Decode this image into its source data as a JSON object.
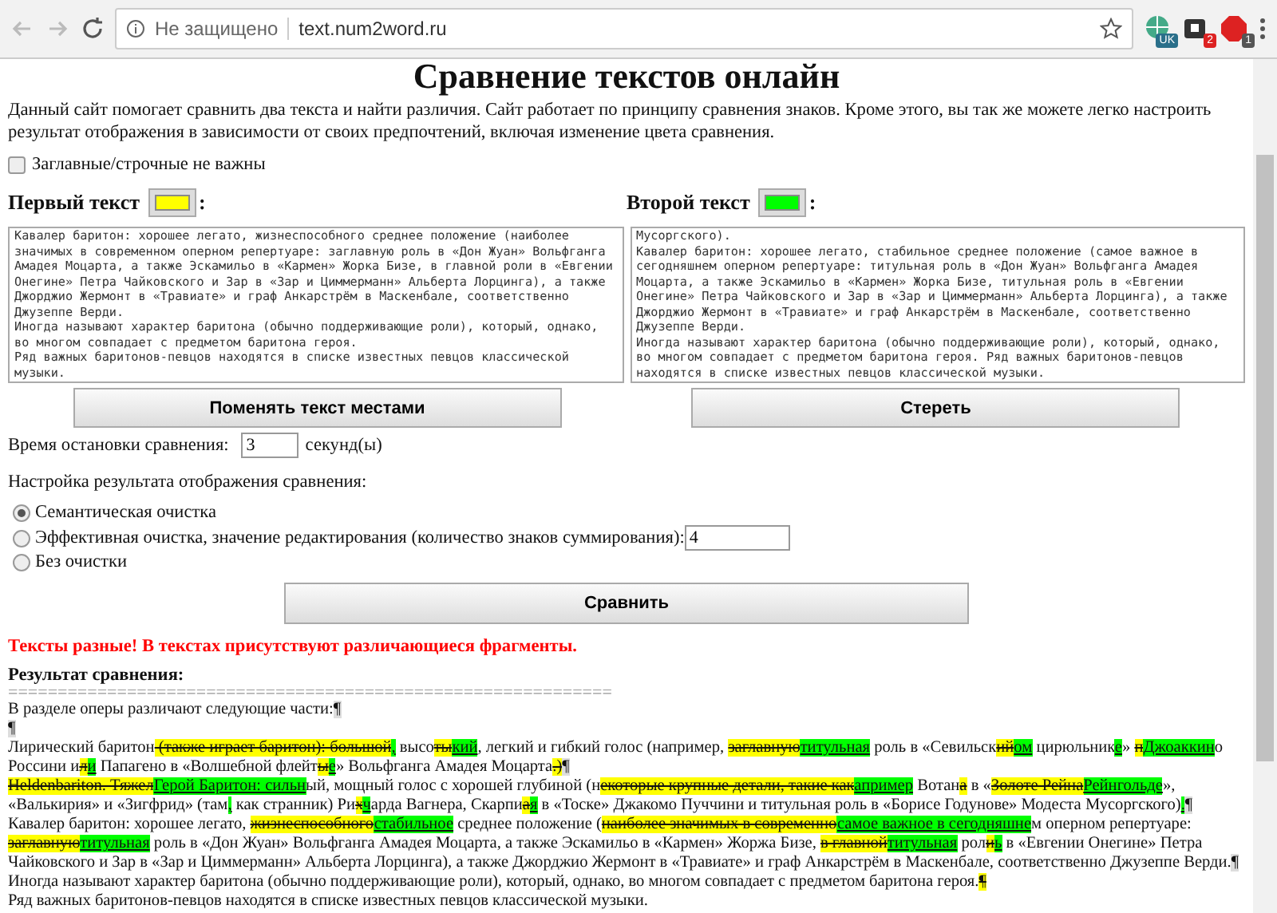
{
  "browser": {
    "security": "Не защищено",
    "url": "text.num2word.ru",
    "extensions": [
      {
        "kind": "globe",
        "badge": "UK"
      },
      {
        "kind": "puzzle",
        "badge": "2"
      },
      {
        "kind": "stop",
        "badge": "1"
      }
    ]
  },
  "title": "Сравнение текстов онлайн",
  "intro": "Данный сайт помогает сравнить два текста и найти различия. Сайт работает по принципу сравнения знаков. Кроме этого, вы так же можете легко настроить результат отображения в зависимости от своих предпочтений, включая изменение цвета сравнения.",
  "case_option": {
    "label": "Заглавные/строчные не важны",
    "checked": false
  },
  "texts": [
    {
      "label": "Первый текст",
      "suffix": ":",
      "color": "#ffff00",
      "value": "Кавалер баритон: хорошее легато, жизнеспособного среднее положение (наиболее значимых в современном оперном репертуаре: заглавную роль в «Дон Жуан» Вольфганга Амадея Моцарта, а также Эскамильо в «Кармен» Жорка Бизе, в главной роли в «Евгении Онегине» Петра Чайковского и Зар в «Зар и Циммерманн» Альберта Лорцинга), а также Джорджио Жермонт в «Травиате» и граф Анкарстрём в Маскенбале, соответственно Джузеппе Верди.\nИногда называют характер баритона (обычно поддерживающие роли), который, однако, во многом совпадает с предметом баритона героя.\nРяд важных баритонов-певцов находятся в списке известных певцов классической музыки."
    },
    {
      "label": "Второй текст",
      "suffix": ":",
      "color": "#00ff00",
      "value": "Мусоргского).\nКавалер баритон: хорошее легато, стабильное среднее положение (самое важное в сегодняшнем оперном репертуаре: титульная роль в «Дон Жуан» Вольфганга Амадея Моцарта, а также Эскамильо в «Кармен» Жорка Бизе, титульная роль в «Евгении Онегине» Петра Чайковского и Зар в «Зар и Циммерманн» Альберта Лорцинга), а также Джорджио Жермонт в «Травиате» и граф Анкарстрём в Маскенбале, соответственно Джузеппе Верди.\nИногда называют характер баритона (обычно поддерживающие роли), который, однако, во многом совпадает с предметом баритона героя. Ряд важных баритонов-певцов находятся в списке известных певцов классической музыки."
    }
  ],
  "buttons": [
    "Поменять текст местами",
    "Стереть"
  ],
  "timeout": {
    "label": "Время остановки сравнения:",
    "value": "3",
    "unit": "секунд(ы)"
  },
  "settings": {
    "label": "Настройка результата отображения сравнения:",
    "options": [
      {
        "label": "Семантическая очистка",
        "selected": true
      },
      {
        "label": "Эффективная очистка, значение редактирования (количество знаков суммирования):",
        "selected": false,
        "value": "4"
      },
      {
        "label": "Без очистки",
        "selected": false
      }
    ]
  },
  "compare_button": "Сравнить",
  "message": "Тексты разные! В текстах присутствуют различающиеся фрагменты.",
  "result": {
    "title": "Результат сравнения:",
    "separator": "=============================================================",
    "paragraphs": [
      [
        {
          "kind": "same",
          "text": "В разделе оперы различают следующие части:"
        },
        {
          "kind": "mark",
          "text": "¶"
        }
      ],
      [
        {
          "kind": "mark",
          "text": "¶"
        }
      ],
      [
        {
          "kind": "same",
          "text": "Лирический баритон"
        },
        {
          "kind": "del",
          "text": " (также играет баритон): большой"
        },
        {
          "kind": "ins",
          "text": ","
        },
        {
          "kind": "same",
          "text": " высо"
        },
        {
          "kind": "del",
          "text": "ты"
        },
        {
          "kind": "ins",
          "text": "кий"
        },
        {
          "kind": "same",
          "text": ", легкий и гибкий голос (например, "
        },
        {
          "kind": "del",
          "text": "заглавную"
        },
        {
          "kind": "ins",
          "text": "титульная"
        },
        {
          "kind": "same",
          "text": " роль в «Севильск"
        },
        {
          "kind": "del",
          "text": "ий"
        },
        {
          "kind": "ins",
          "text": "ом"
        },
        {
          "kind": "same",
          "text": " цирюльник"
        },
        {
          "kind": "ins",
          "text": "е"
        },
        {
          "kind": "same",
          "text": "» "
        },
        {
          "kind": "del",
          "text": "п"
        },
        {
          "kind": "ins",
          "text": "Джоаккин"
        },
        {
          "kind": "same",
          "text": "о Россини и"
        },
        {
          "kind": "del",
          "text": "л"
        },
        {
          "kind": "ins",
          "text": "и"
        },
        {
          "kind": "same",
          "text": " Папагено в «Волшебной флейт"
        },
        {
          "kind": "del",
          "text": "ы"
        },
        {
          "kind": "ins",
          "text": "е"
        },
        {
          "kind": "same",
          "text": "» Вольфганга Амадея Моцарта"
        },
        {
          "kind": "del",
          "text": ".)"
        },
        {
          "kind": "mark",
          "text": "¶"
        }
      ],
      [
        {
          "kind": "del",
          "text": "Heldenbariton. Тяжел"
        },
        {
          "kind": "ins",
          "text": "Герой Баритон: сильн"
        },
        {
          "kind": "same",
          "text": "ый, мощный голос с хорошей глубиной (н"
        },
        {
          "kind": "del",
          "text": "екоторые крупные детали, такие как"
        },
        {
          "kind": "ins",
          "text": "апример"
        },
        {
          "kind": "same",
          "text": " Вотан"
        },
        {
          "kind": "del",
          "text": "а"
        },
        {
          "kind": "same",
          "text": " в «"
        },
        {
          "kind": "del",
          "text": "Золоте Рейна"
        },
        {
          "kind": "ins",
          "text": "Рейнгольде"
        },
        {
          "kind": "same",
          "text": "», «Валькирия» и «Зигфрид» (там"
        },
        {
          "kind": "ins",
          "text": ","
        },
        {
          "kind": "same",
          "text": " как странник) Ри"
        },
        {
          "kind": "del",
          "text": "х"
        },
        {
          "kind": "ins",
          "text": "ч"
        },
        {
          "kind": "same",
          "text": "арда Вагнера, Скарпи"
        },
        {
          "kind": "del",
          "text": "а"
        },
        {
          "kind": "ins",
          "text": "я"
        },
        {
          "kind": "same",
          "text": " в «Toске» Джакомо Пуччини и титульная роль в «Борисе Годунове» Модеста Мусоргского)"
        },
        {
          "kind": "ins",
          "text": "."
        },
        {
          "kind": "mark",
          "text": "¶"
        }
      ],
      [
        {
          "kind": "same",
          "text": "Кавалер баритон: хорошее легато, "
        },
        {
          "kind": "del",
          "text": "жизнеспособного"
        },
        {
          "kind": "ins",
          "text": "стабильное"
        },
        {
          "kind": "same",
          "text": " среднее положение ("
        },
        {
          "kind": "del",
          "text": "наиболее значимых в современно"
        },
        {
          "kind": "ins",
          "text": "самое важное в сегодняшне"
        },
        {
          "kind": "same",
          "text": "м оперном репертуаре: "
        },
        {
          "kind": "del",
          "text": "заглавную"
        },
        {
          "kind": "ins",
          "text": "титульная"
        },
        {
          "kind": "same",
          "text": " роль в «Дон Жуан» Вольфганга Амадея Моцарта, а также Эскамильо в «Кармен» Жоржа Бизе, "
        },
        {
          "kind": "del",
          "text": "в главной"
        },
        {
          "kind": "ins",
          "text": "титульная"
        },
        {
          "kind": "same",
          "text": " рол"
        },
        {
          "kind": "del",
          "text": "и"
        },
        {
          "kind": "ins",
          "text": "ь"
        },
        {
          "kind": "same",
          "text": " в «Евгении Онегине» Петра Чайковского и Зар в «Зар и Циммерманн» Альберта Лорцинга), а также Джорджио Жермонт в «Травиате» и граф Анкарстрём в Маскенбале, соответственно Джузеппе Верди."
        },
        {
          "kind": "mark",
          "text": "¶"
        }
      ],
      [
        {
          "kind": "same",
          "text": "Иногда называют характер баритона (обычно поддерживающие роли), который, однако, во многом совпадает с предметом баритона героя."
        },
        {
          "kind": "del",
          "text": "¶"
        }
      ],
      [
        {
          "kind": "same",
          "text": "Ряд важных баритонов-певцов находятся в списке известных певцов классической музыки."
        }
      ]
    ]
  }
}
